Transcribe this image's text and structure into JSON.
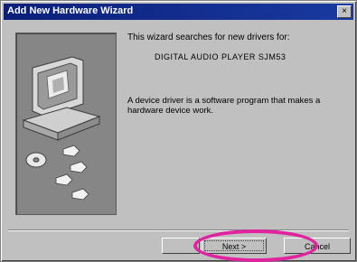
{
  "window": {
    "title": "Add New Hardware Wizard",
    "close_label": "×"
  },
  "content": {
    "intro": "This wizard searches for new drivers for:",
    "device_name": "DIGITAL AUDIO PLAYER SJM53",
    "description": "A device driver is a software program that makes a hardware device work."
  },
  "buttons": {
    "back_label": "",
    "next_label": "Next >",
    "cancel_label": "Cancel"
  },
  "colors": {
    "title_bar": "#0a1f7a",
    "window_bg": "#c0c0c0",
    "art_panel": "#868686",
    "highlight": "#e0239e"
  },
  "icons": {
    "illustration": "computer-with-cd-icon",
    "arrows": "arrow-icon",
    "disc": "cd-disc-icon"
  }
}
